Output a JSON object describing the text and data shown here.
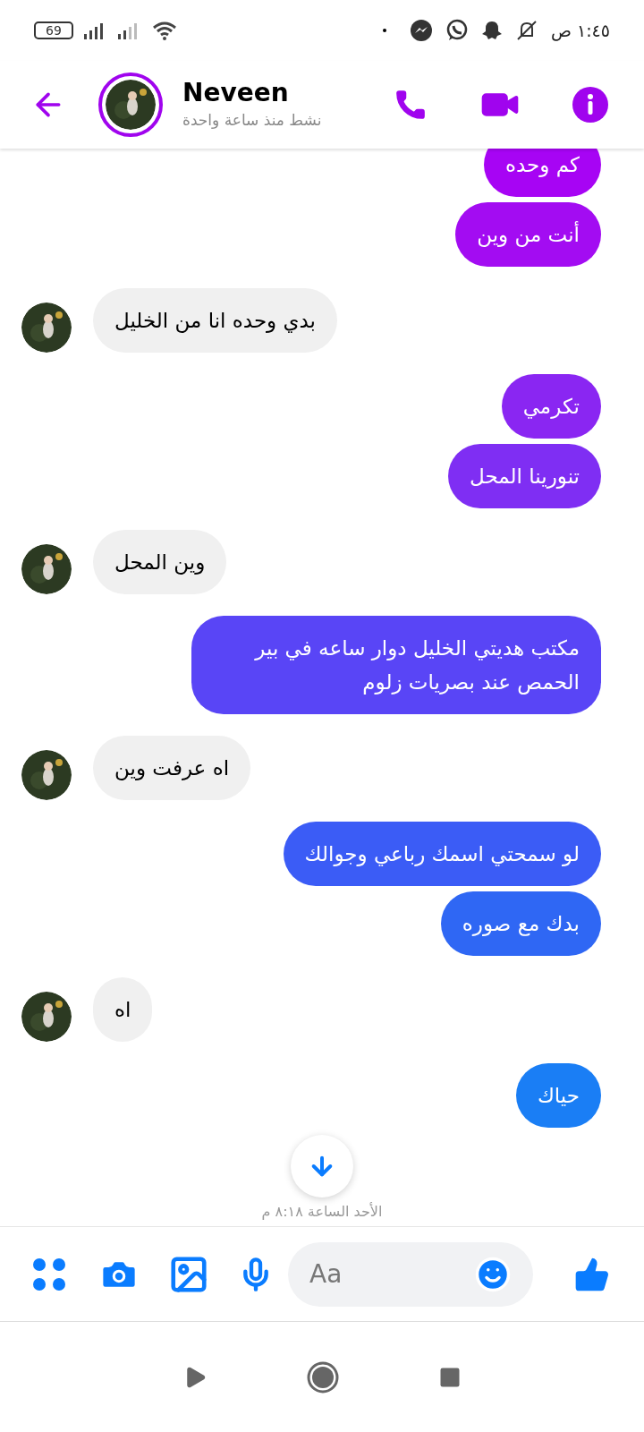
{
  "status_bar": {
    "battery": "69",
    "time": "١:٤٥ ص"
  },
  "header": {
    "name": "Neveen",
    "status": "نشط منذ ساعة واحدة"
  },
  "messages": [
    {
      "kind": "outgoing",
      "text": "كم وحده",
      "color": "#a704f4"
    },
    {
      "kind": "outgoing",
      "text": "أنت من وين",
      "color": "#a30cf2"
    },
    {
      "kind": "incoming",
      "text": "بدي وحده انا من الخليل"
    },
    {
      "kind": "outgoing",
      "text": "تكرمي",
      "color": "#8a26f2"
    },
    {
      "kind": "outgoing",
      "text": "تنورينا المحل",
      "color": "#7f2ef3"
    },
    {
      "kind": "incoming",
      "text": "وين المحل"
    },
    {
      "kind": "outgoing",
      "text": "مكتب هديتي الخليل دوار ساعه في بير الحمص عند بصريات زلوم",
      "color": "#5945f6"
    },
    {
      "kind": "incoming",
      "text": "اه عرفت وين"
    },
    {
      "kind": "outgoing",
      "text": "لو سمحتي اسمك رباعي وجوالك",
      "color": "#3b5cf6"
    },
    {
      "kind": "outgoing",
      "text": "بدك مع صوره",
      "color": "#2f67f4"
    },
    {
      "kind": "incoming",
      "text": "اه"
    },
    {
      "kind": "outgoing",
      "text": "حياك",
      "color": "#1a7ef5"
    }
  ],
  "timestamp": "الأحد الساعة ٨:١٨ م",
  "composer": {
    "placeholder": "Aa"
  }
}
